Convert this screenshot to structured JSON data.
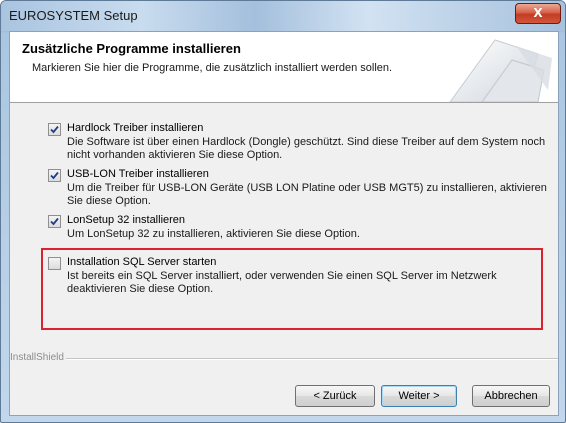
{
  "window": {
    "title": "EUROSYSTEM Setup",
    "close_symbol": "X"
  },
  "header": {
    "title": "Zusätzliche Programme installieren",
    "subtitle": "Markieren Sie hier die Programme, die zusätzlich installiert werden sollen."
  },
  "options": [
    {
      "label": "Hardlock Treiber installieren",
      "checked": true,
      "description": "Die Software ist über einen Hardlock (Dongle) geschützt. Sind diese Treiber auf dem System noch nicht vorhanden aktivieren Sie diese Option."
    },
    {
      "label": "USB-LON Treiber installieren",
      "checked": true,
      "description": "Um die Treiber für USB-LON Geräte (USB LON Platine oder USB MGT5) zu installieren, aktivieren Sie diese Option."
    },
    {
      "label": "LonSetup 32 installieren",
      "checked": true,
      "description": "Um LonSetup 32 zu installieren, aktivieren Sie diese Option."
    },
    {
      "label": "Installation SQL Server starten",
      "checked": false,
      "description": "Ist bereits ein SQL Server installiert, oder verwenden Sie einen SQL Server im Netzwerk deaktivieren Sie diese Option."
    }
  ],
  "footer": {
    "brand": "InstallShield",
    "back_label": "< Zurück",
    "next_label": "Weiter >",
    "cancel_label": "Abbrechen"
  },
  "colors": {
    "highlight_box": "#d9232f",
    "title_bar": "#a9c4e0"
  }
}
